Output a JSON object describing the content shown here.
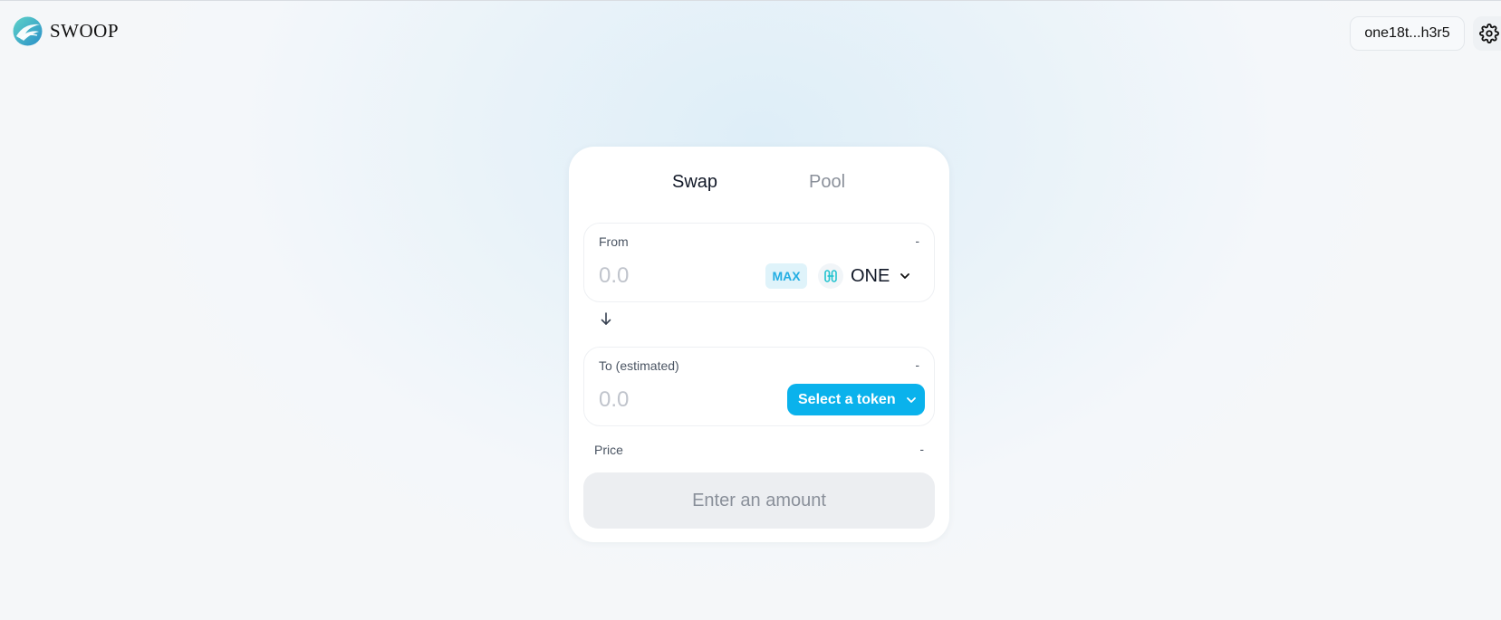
{
  "header": {
    "logo_text": "SWOOP",
    "wallet_address": "one18t...h3r5",
    "settings_icon": "gear-icon"
  },
  "tabs": [
    {
      "label": "Swap",
      "active": true
    },
    {
      "label": "Pool",
      "active": false
    }
  ],
  "from": {
    "label": "From",
    "balance": "-",
    "amount_placeholder": "0.0",
    "max_label": "MAX",
    "token": "ONE",
    "token_icon": "harmony-one-icon"
  },
  "switch_icon": "arrow-down-icon",
  "to": {
    "label": "To (estimated)",
    "balance": "-",
    "amount_placeholder": "0.0",
    "select_label": "Select a token"
  },
  "price": {
    "label": "Price",
    "value": "-"
  },
  "submit_label": "Enter an amount",
  "colors": {
    "accent": "#0ab2ec",
    "max_text": "#23aee3",
    "max_bg": "#dff3fa",
    "muted": "#8a909a",
    "card_bg": "#ffffff"
  }
}
